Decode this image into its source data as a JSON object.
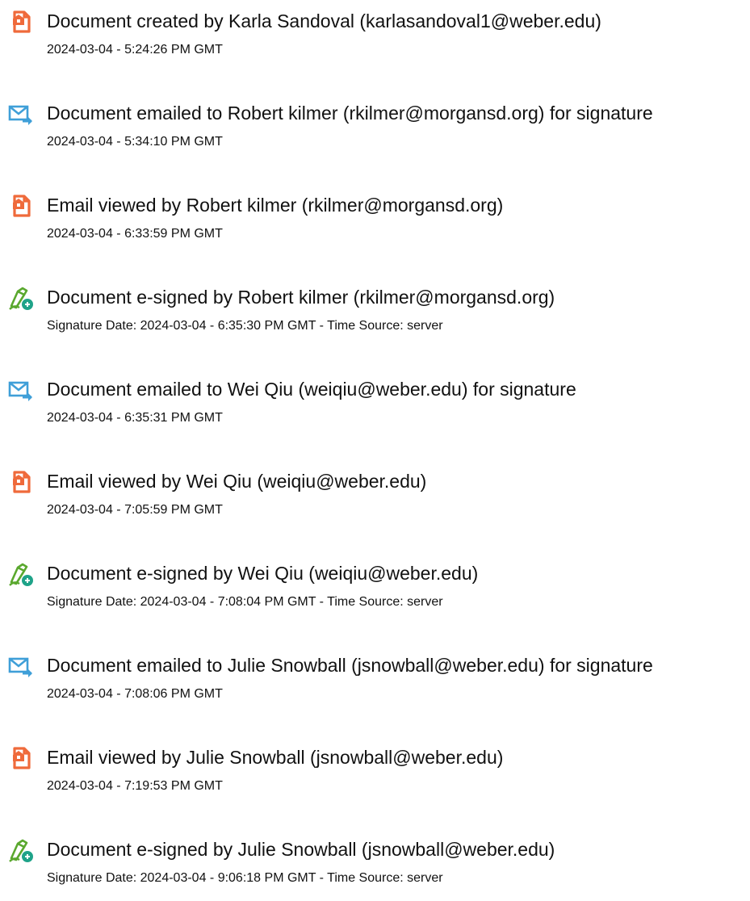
{
  "colors": {
    "document_icon": "#ef6a3b",
    "email_icon": "#3f9fd8",
    "sign_icon": "#5aa82e",
    "sign_badge": "#1fa389",
    "text": "#111111"
  },
  "events": [
    {
      "icon": "document-icon",
      "title": "Document created by Karla Sandoval (karlasandoval1@weber.edu)",
      "time": "2024-03-04 - 5:24:26 PM GMT"
    },
    {
      "icon": "email-send-icon",
      "title": "Document emailed to Robert kilmer (rkilmer@morgansd.org) for signature",
      "time": "2024-03-04 - 5:34:10 PM GMT"
    },
    {
      "icon": "document-icon",
      "title": "Email viewed by Robert kilmer (rkilmer@morgansd.org)",
      "time": "2024-03-04 - 6:33:59 PM GMT"
    },
    {
      "icon": "esign-pen-icon",
      "title": "Document e-signed by Robert kilmer (rkilmer@morgansd.org)",
      "time": "Signature Date: 2024-03-04 - 6:35:30 PM GMT - Time Source: server"
    },
    {
      "icon": "email-send-icon",
      "title": "Document emailed to Wei Qiu (weiqiu@weber.edu) for signature",
      "time": "2024-03-04 - 6:35:31 PM GMT"
    },
    {
      "icon": "document-icon",
      "title": "Email viewed by Wei Qiu (weiqiu@weber.edu)",
      "time": "2024-03-04 - 7:05:59 PM GMT"
    },
    {
      "icon": "esign-pen-icon",
      "title": "Document e-signed by Wei Qiu (weiqiu@weber.edu)",
      "time": "Signature Date: 2024-03-04 - 7:08:04 PM GMT - Time Source: server"
    },
    {
      "icon": "email-send-icon",
      "title": "Document emailed to Julie Snowball (jsnowball@weber.edu) for signature",
      "time": "2024-03-04 - 7:08:06 PM GMT"
    },
    {
      "icon": "document-icon",
      "title": "Email viewed by Julie Snowball (jsnowball@weber.edu)",
      "time": "2024-03-04 - 7:19:53 PM GMT"
    },
    {
      "icon": "esign-pen-icon",
      "title": "Document e-signed by Julie Snowball (jsnowball@weber.edu)",
      "time": "Signature Date: 2024-03-04 - 9:06:18 PM GMT - Time Source: server"
    }
  ]
}
